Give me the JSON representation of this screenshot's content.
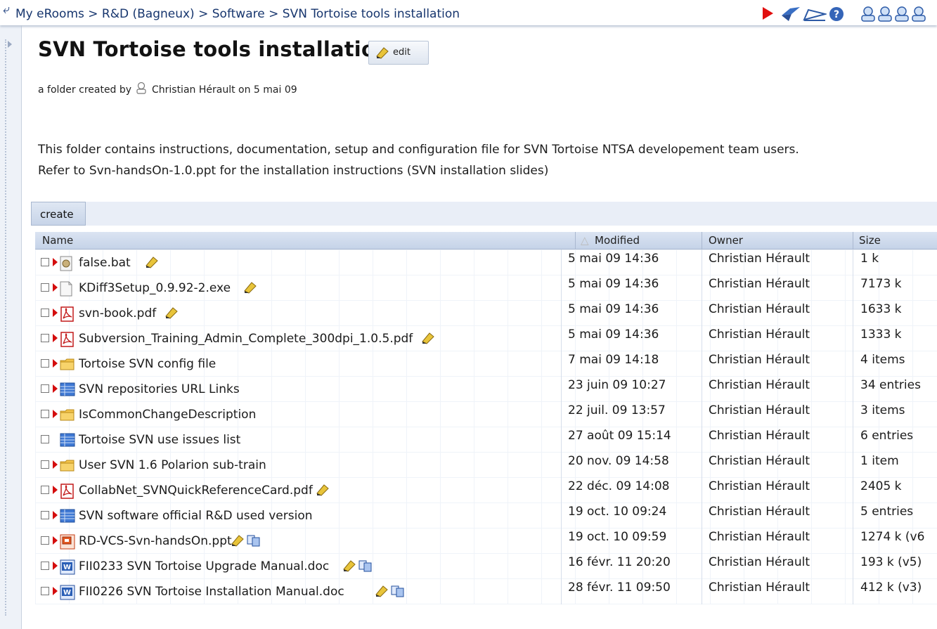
{
  "breadcrumb": [
    "My eRooms",
    "R&D (Bagneux)",
    "Software",
    "SVN Tortoise tools installation"
  ],
  "breadcrumb_sep": ">",
  "title": "SVN Tortoise tools installation",
  "edit_label": "edit",
  "creator": {
    "prefix": "a folder created by",
    "name": "Christian Hérault",
    "suffix": "on 5 mai 09"
  },
  "description": [
    "This folder contains instructions, documentation, setup and configuration file for SVN Tortoise NTSA developement team users.",
    "Refer to Svn-handsOn-1.0.ppt for the installation instructions (SVN installation slides)"
  ],
  "create_label": "create",
  "columns": {
    "name": "Name",
    "modified": "Modified",
    "owner": "Owner",
    "size": "Size"
  },
  "rows": [
    {
      "name": "false.bat",
      "icon": "bat-file-icon",
      "modified": "5 mai 09  14:36",
      "owner": "Christian Hérault",
      "size": "1 k",
      "arrow": true,
      "edit": true,
      "versions": false
    },
    {
      "name": "KDiff3Setup_0.9.92-2.exe",
      "icon": "exe-file-icon",
      "modified": "5 mai 09  14:36",
      "owner": "Christian Hérault",
      "size": "7173 k",
      "arrow": true,
      "edit": true,
      "versions": false
    },
    {
      "name": "svn-book.pdf",
      "icon": "pdf-file-icon",
      "modified": "5 mai 09  14:36",
      "owner": "Christian Hérault",
      "size": "1633 k",
      "arrow": true,
      "edit": true,
      "versions": false
    },
    {
      "name": "Subversion_Training_Admin_Complete_300dpi_1.0.5.pdf",
      "icon": "pdf-file-icon",
      "modified": "5 mai 09  14:36",
      "owner": "Christian Hérault",
      "size": "1333 k",
      "arrow": true,
      "edit": true,
      "versions": false
    },
    {
      "name": "Tortoise SVN config file",
      "icon": "folder-icon",
      "modified": "7 mai 09  14:18",
      "owner": "Christian Hérault",
      "size": "4 items",
      "arrow": true,
      "edit": false,
      "versions": false
    },
    {
      "name": "SVN repositories URL Links",
      "icon": "database-icon",
      "modified": "23 juin 09  10:27",
      "owner": "Christian Hérault",
      "size": "34 entries",
      "arrow": true,
      "edit": false,
      "versions": false
    },
    {
      "name": "IsCommonChangeDescription",
      "icon": "folder-icon",
      "modified": "22 juil. 09  13:57",
      "owner": "Christian Hérault",
      "size": "3 items",
      "arrow": true,
      "edit": false,
      "versions": false
    },
    {
      "name": "Tortoise SVN use issues list",
      "icon": "database-icon",
      "modified": "27 août 09  15:14",
      "owner": "Christian Hérault",
      "size": "6 entries",
      "arrow": false,
      "edit": false,
      "versions": false
    },
    {
      "name": "User SVN 1.6 Polarion sub-train",
      "icon": "folder-icon",
      "modified": "20 nov. 09  14:58",
      "owner": "Christian Hérault",
      "size": "1 item",
      "arrow": true,
      "edit": false,
      "versions": false
    },
    {
      "name": "CollabNet_SVNQuickReferenceCard.pdf",
      "icon": "pdf-file-icon",
      "modified": "22 déc. 09  14:08",
      "owner": "Christian Hérault",
      "size": "2405 k",
      "arrow": true,
      "edit": true,
      "versions": false
    },
    {
      "name": "SVN software official R&D used version",
      "icon": "database-icon",
      "modified": "19 oct. 10  09:24",
      "owner": "Christian Hérault",
      "size": "5 entries",
      "arrow": true,
      "edit": false,
      "versions": false
    },
    {
      "name": "RD-VCS-Svn-handsOn.ppt",
      "icon": "ppt-file-icon",
      "modified": "19 oct. 10  09:59",
      "owner": "Christian Hérault",
      "size": "1274 k (v6",
      "arrow": true,
      "edit": true,
      "versions": true
    },
    {
      "name": "FII0233 SVN Tortoise Upgrade Manual.doc",
      "icon": "word-file-icon",
      "modified": "16 févr. 11  20:20",
      "owner": "Christian Hérault",
      "size": "193 k (v5)",
      "arrow": true,
      "edit": true,
      "versions": true
    },
    {
      "name": "FII0226 SVN Tortoise Installation Manual.doc",
      "icon": "word-file-icon",
      "modified": "28 févr. 11  09:50",
      "owner": "Christian Hérault",
      "size": "412 k (v3)",
      "arrow": true,
      "edit": true,
      "versions": true
    }
  ],
  "colors": {
    "crumb": "#17366e",
    "accent_red": "#d40d0d",
    "header_bg": "#c5d3e8",
    "folder": "#f3c44b"
  }
}
